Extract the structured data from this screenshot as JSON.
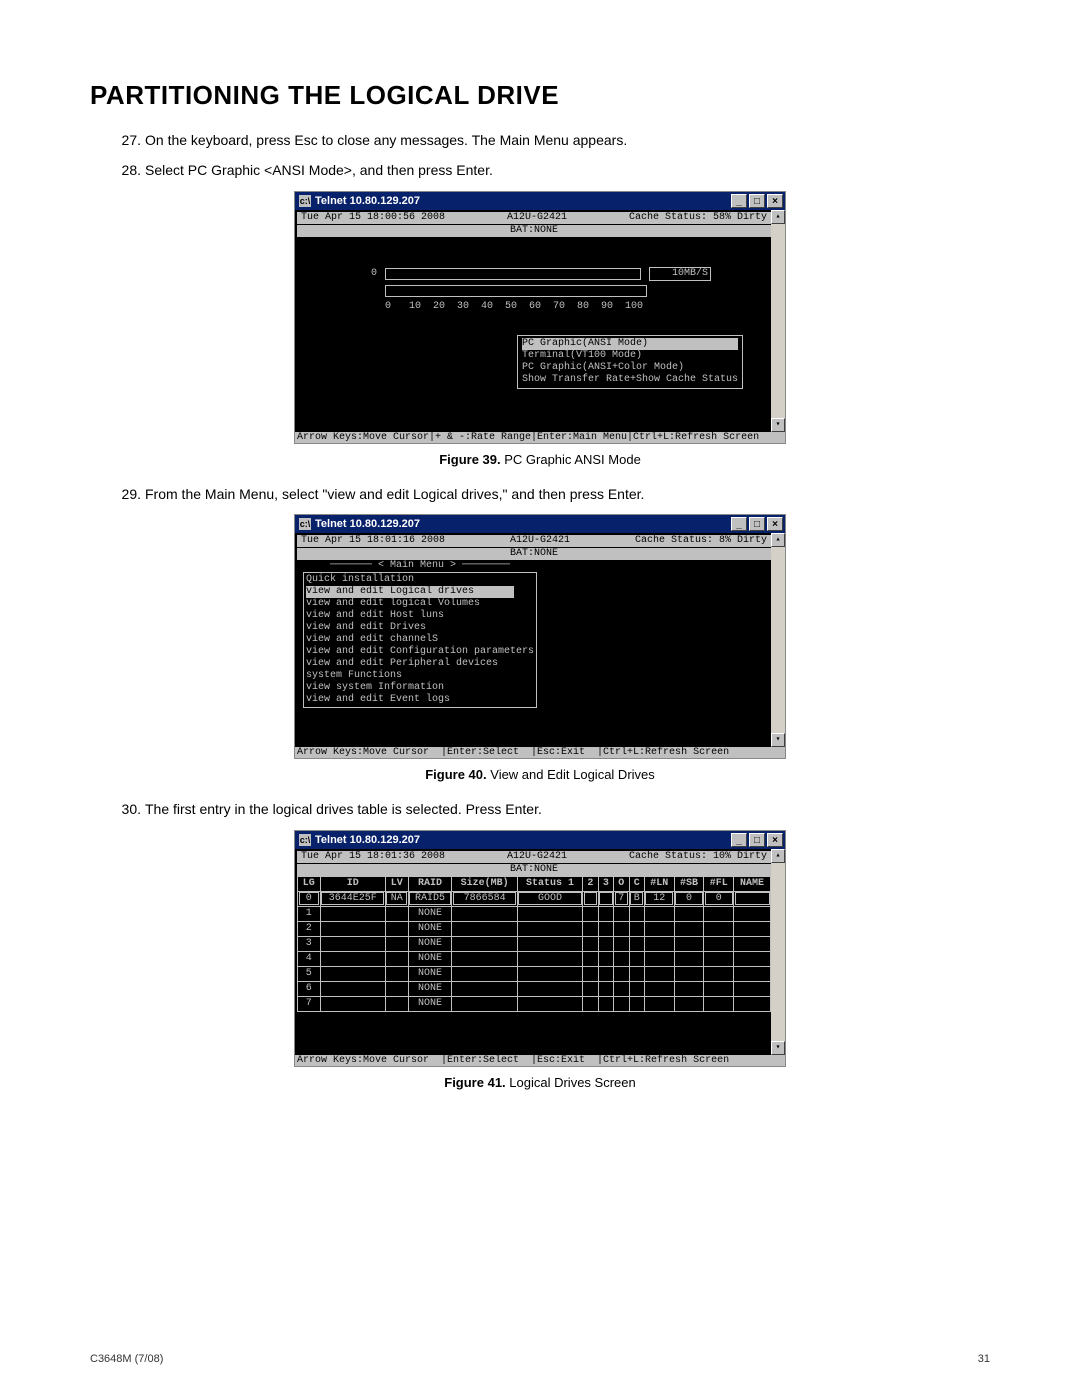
{
  "title": "PARTITIONING THE LOGICAL DRIVE",
  "steps": [
    {
      "num": "27.",
      "text": "On the keyboard, press Esc to close any messages. The Main Menu appears."
    },
    {
      "num": "28.",
      "text": "Select PC Graphic <ANSI Mode>, and then press Enter."
    },
    {
      "num": "29.",
      "text": "From the Main Menu, select \"view and edit Logical drives,\" and then press Enter."
    },
    {
      "num": "30.",
      "text": "The first entry in the logical drives table is selected. Press Enter."
    }
  ],
  "figcaps": {
    "39": {
      "b": "Figure 39.",
      "t": "  PC Graphic ANSI Mode"
    },
    "40": {
      "b": "Figure 40.",
      "t": "  View and Edit Logical Drives"
    },
    "41": {
      "b": "Figure 41.",
      "t": "  Logical Drives Screen"
    }
  },
  "telnet_title": "Telnet 10.80.129.207",
  "win_btns": {
    "min": "_",
    "max": "□",
    "close": "×"
  },
  "scroll": {
    "up": "▴",
    "down": "▾"
  },
  "fig39": {
    "time": "Tue Apr 15 18:00:56 2008",
    "model": "A12U-G2421",
    "cache": "Cache Status:  58% Dirty",
    "bat": "BAT:NONE",
    "gauge_val": "0",
    "gauge_rate": "10MB/S",
    "gauge_scale": "0   10  20  30  40  50  60  70  80  90  100",
    "menu": [
      "PC Graphic(ANSI Mode)",
      "Terminal(VT100 Mode)",
      "PC Graphic(ANSI+Color Mode)",
      "Show Transfer Rate+Show Cache Status"
    ],
    "footer": "Arrow Keys:Move Cursor|+ & -:Rate Range|Enter:Main Menu|Ctrl+L:Refresh Screen"
  },
  "fig40": {
    "time": "Tue Apr 15 18:01:16 2008",
    "model": "A12U-G2421",
    "cache": "Cache Status:   8% Dirty",
    "bat": "BAT:NONE",
    "menu_title": "─────── < Main Menu > ────────",
    "menu": [
      "Quick installation",
      "view and edit Logical drives",
      "view and edit logical Volumes",
      "view and edit Host luns",
      "view and edit Drives",
      "view and edit channelS",
      "view and edit Configuration parameters",
      "view and edit Peripheral devices",
      "system Functions",
      "view system Information",
      "view and edit Event logs"
    ],
    "footer": "Arrow Keys:Move Cursor  |Enter:Select  |Esc:Exit  |Ctrl+L:Refresh Screen"
  },
  "fig41": {
    "time": "Tue Apr 15 18:01:36 2008",
    "model": "A12U-G2421",
    "cache": "Cache Status:  10% Dirty",
    "bat": "BAT:NONE",
    "headers": [
      "LG",
      "ID",
      "LV",
      "RAID",
      "Size(MB)",
      "Status 1",
      "2",
      "3",
      "O",
      "C",
      "#LN",
      "#SB",
      "#FL",
      "NAME"
    ],
    "rows": [
      [
        "0",
        "3644E25F",
        "NA",
        "RAID5",
        "7866584",
        "GOOD",
        "",
        "",
        "7",
        "B",
        "12",
        "0",
        "0",
        ""
      ],
      [
        "1",
        "",
        "",
        "NONE",
        "",
        "",
        "",
        "",
        "",
        "",
        "",
        "",
        "",
        ""
      ],
      [
        "2",
        "",
        "",
        "NONE",
        "",
        "",
        "",
        "",
        "",
        "",
        "",
        "",
        "",
        ""
      ],
      [
        "3",
        "",
        "",
        "NONE",
        "",
        "",
        "",
        "",
        "",
        "",
        "",
        "",
        "",
        ""
      ],
      [
        "4",
        "",
        "",
        "NONE",
        "",
        "",
        "",
        "",
        "",
        "",
        "",
        "",
        "",
        ""
      ],
      [
        "5",
        "",
        "",
        "NONE",
        "",
        "",
        "",
        "",
        "",
        "",
        "",
        "",
        "",
        ""
      ],
      [
        "6",
        "",
        "",
        "NONE",
        "",
        "",
        "",
        "",
        "",
        "",
        "",
        "",
        "",
        ""
      ],
      [
        "7",
        "",
        "",
        "NONE",
        "",
        "",
        "",
        "",
        "",
        "",
        "",
        "",
        "",
        ""
      ]
    ],
    "footer": "Arrow Keys:Move Cursor  |Enter:Select  |Esc:Exit  |Ctrl+L:Refresh Screen"
  },
  "page_footer": {
    "left": "C3648M (7/08)",
    "right": "31"
  }
}
